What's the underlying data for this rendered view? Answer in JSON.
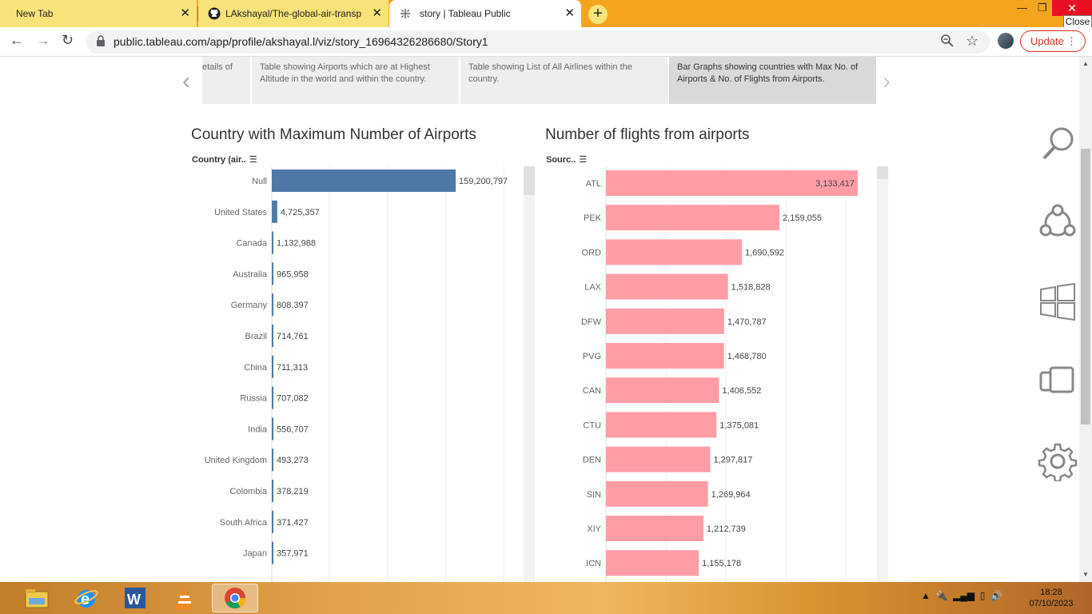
{
  "browser": {
    "tabs": [
      {
        "title": "New Tab",
        "active": false
      },
      {
        "title": "LAkshayal/The-global-air-transpc",
        "active": false
      },
      {
        "title": "story | Tableau Public",
        "active": true
      }
    ],
    "url": "public.tableau.com/app/profile/akshayal.l/viz/story_16964326286680/Story1",
    "update_label": "Update",
    "close_tooltip": "Close"
  },
  "story": {
    "points": [
      "etails of",
      "Table showing Airports which are at Highest Altitude in the world and within the country.",
      "Table showing List of All Airlines within the country.",
      "Bar Graphs showing countries with Max No. of Airports & No. of Flights from Airports."
    ],
    "active_index": 3
  },
  "chart_data": [
    {
      "type": "bar",
      "orientation": "horizontal",
      "title": "Country with Maximum Number of Airports",
      "field_label": "Country (air..",
      "color": "#4e79a7",
      "categories": [
        "Null",
        "United States",
        "Canada",
        "Australia",
        "Germany",
        "Brazil",
        "China",
        "Russia",
        "India",
        "United Kingdom",
        "Colombia",
        "South Africa",
        "Japan"
      ],
      "values": [
        159200797,
        4725357,
        1132988,
        965958,
        808397,
        714761,
        711313,
        707082,
        556707,
        493273,
        378219,
        371427,
        357971
      ],
      "labels": [
        "159,200,797",
        "4,725,357",
        "1,132,988",
        "965,958",
        "808,397",
        "714,761",
        "711,313",
        "707,082",
        "556,707",
        "493,273",
        "378,219",
        "371,427",
        "357,971"
      ],
      "xlim": [
        0,
        159200797
      ]
    },
    {
      "type": "bar",
      "orientation": "horizontal",
      "title": "Number of flights from airports",
      "field_label": "Sourc..",
      "color": "#ff9da7",
      "categories": [
        "ATL",
        "PEK",
        "ORD",
        "LAX",
        "DFW",
        "PVG",
        "CAN",
        "CTU",
        "DEN",
        "SIN",
        "XIY",
        "ICN"
      ],
      "values": [
        3133417,
        2159055,
        1690592,
        1518828,
        1470787,
        1468780,
        1406552,
        1375081,
        1297817,
        1269964,
        1212739,
        1155178
      ],
      "labels": [
        "3,133,417",
        "2,159,055",
        "1,690,592",
        "1,518,828",
        "1,470,787",
        "1,468,780",
        "1,406,552",
        "1,375,081",
        "1,297,817",
        "1,269,964",
        "1,212,739",
        "1,155,178"
      ],
      "xlim": [
        0,
        3133417
      ]
    }
  ],
  "side_icons": [
    "search-icon",
    "share-icon",
    "windows-icon",
    "devices-icon",
    "settings-icon"
  ],
  "taskbar": {
    "apps": [
      "file-explorer-icon",
      "internet-explorer-icon",
      "word-icon",
      "vlc-icon",
      "chrome-icon"
    ],
    "time": "18:28",
    "date": "07/10/2023"
  }
}
